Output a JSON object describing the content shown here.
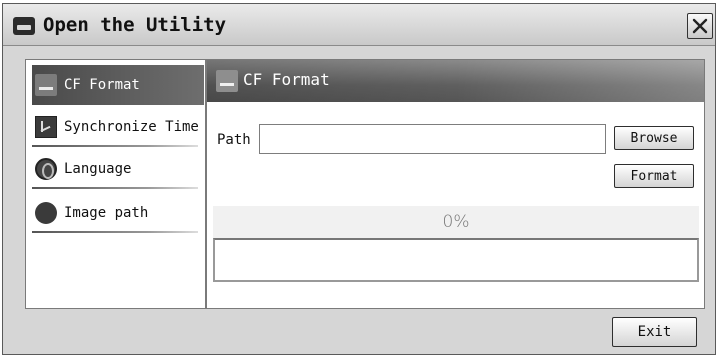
{
  "window": {
    "title": "Open the Utility",
    "close_glyph": "✕"
  },
  "sidebar": {
    "items": [
      {
        "label": "CF Format",
        "icon": "save-icon",
        "active": true
      },
      {
        "label": "Synchronize Time",
        "icon": "clock-icon",
        "active": false
      },
      {
        "label": "Language",
        "icon": "language-icon",
        "active": false
      },
      {
        "label": "Image path",
        "icon": "image-path-icon",
        "active": false
      }
    ]
  },
  "panel": {
    "title": "CF Format",
    "path_label": "Path",
    "path_value": "",
    "browse_label": "Browse",
    "format_label": "Format",
    "progress_percent": 0,
    "progress_text": "0%",
    "log_text": ""
  },
  "footer": {
    "exit_label": "Exit"
  },
  "colors": {
    "active_item_bg": "#555555",
    "panel_header_bg": "#5f5f5f",
    "window_bg": "#d6d6d6"
  }
}
